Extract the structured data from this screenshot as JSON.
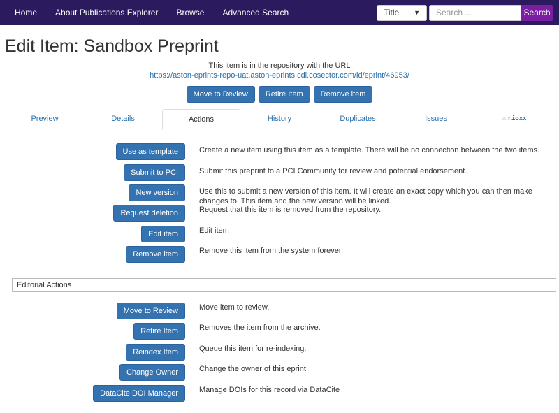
{
  "nav": {
    "links": [
      "Home",
      "About Publications Explorer",
      "Browse",
      "Advanced Search"
    ],
    "select_value": "Title",
    "search_placeholder": "Search ...",
    "search_button": "Search"
  },
  "page_title": "Edit Item: Sandbox Preprint",
  "repo_notice": "This item is in the repository with the URL",
  "repo_url": "https://aston-eprints-repo-uat.aston-eprints.cdl.cosector.com/id/eprint/46953/",
  "top_buttons": [
    "Move to Review",
    "Retire Item",
    "Remove item"
  ],
  "tabs": [
    "Preview",
    "Details",
    "Actions",
    "History",
    "Duplicates",
    "Issues",
    "rioxx"
  ],
  "actions": [
    {
      "label": "Use as template",
      "desc": "Create a new item using this item as a template. There will be no connection between the two items."
    },
    {
      "label": "Submit to PCI",
      "desc": "Submit this preprint to a PCI Community for review and potential endorsement."
    },
    {
      "label": "New version",
      "desc": "Use this to submit a new version of this item. It will create an exact copy which you can then make changes to. This item and the new version will be linked."
    },
    {
      "label": "Request deletion",
      "desc": "Request that this item is removed from the repository."
    },
    {
      "label": "Edit item",
      "desc": "Edit item"
    },
    {
      "label": "Remove item",
      "desc": "Remove this item from the system forever."
    }
  ],
  "editorial_header": "Editorial Actions",
  "editorial_actions": [
    {
      "label": "Move to Review",
      "desc": "Move item to review."
    },
    {
      "label": "Retire Item",
      "desc": "Removes the item from the archive."
    },
    {
      "label": "Reindex Item",
      "desc": "Queue this item for re-indexing."
    },
    {
      "label": "Change Owner",
      "desc": "Change the owner of this eprint"
    },
    {
      "label": "DataCite DOI Manager",
      "desc": "Manage DOIs for this record via DataCite"
    }
  ]
}
